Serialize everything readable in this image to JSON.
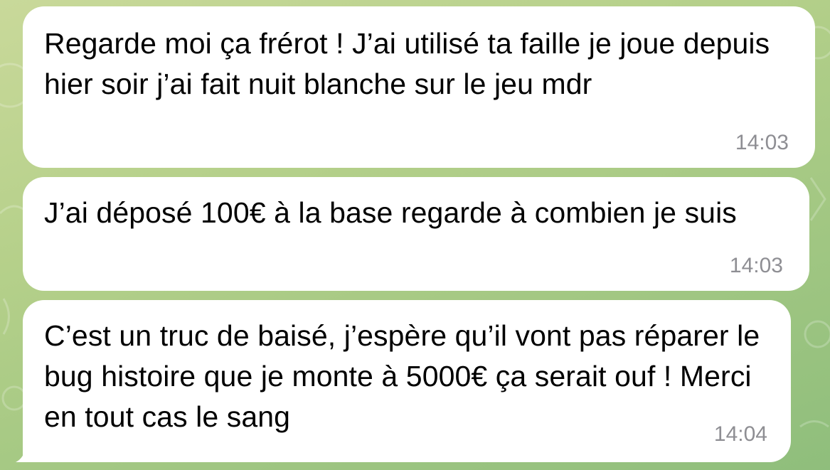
{
  "chat": {
    "messages": [
      {
        "text": "Regarde moi ça frérot ! J’ai utilisé ta faille je joue depuis hier soir j’ai fait nuit blanche sur le jeu mdr",
        "time": "14:03"
      },
      {
        "text": "J’ai déposé 100€ à la base regarde à combien je suis",
        "time": "14:03"
      },
      {
        "text": "C’est un truc de baisé, j’espère qu’il vont pas réparer le bug histoire que je monte à 5000€ ça serait ouf ! Merci en tout cas le sang",
        "time": "14:04"
      }
    ]
  },
  "colors": {
    "bubble": "#ffffff",
    "timestamp": "#8e8e93",
    "wallpaper_light": "#c9d99a",
    "wallpaper_dark": "#8fbe7c"
  }
}
